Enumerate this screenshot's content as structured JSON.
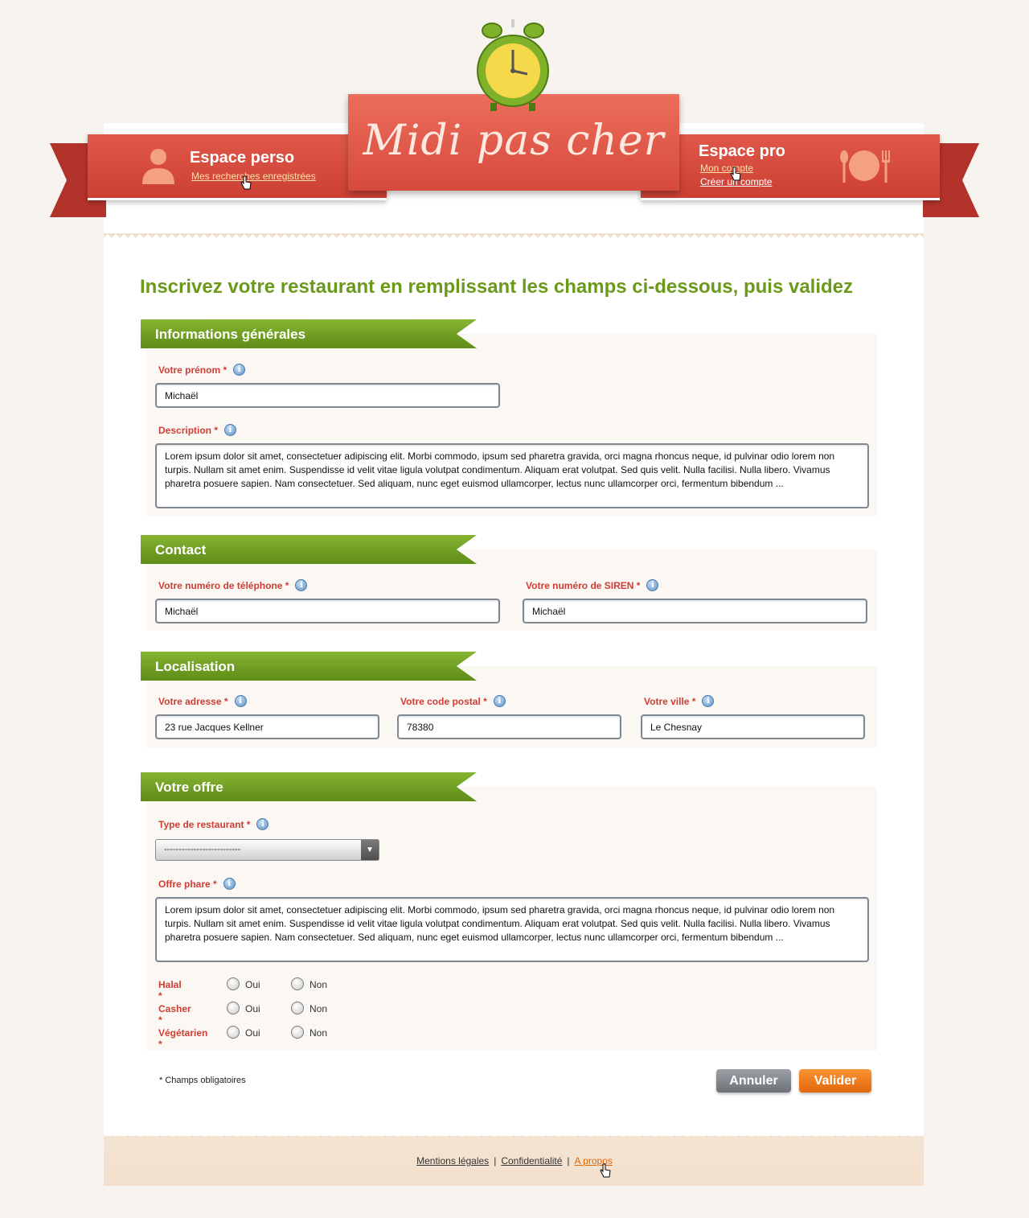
{
  "brand": {
    "logo_text": "Midi pas cher",
    "ribbon_color": "#d94b3d",
    "green_accent": "#6a9a1a"
  },
  "header": {
    "perso": {
      "title": "Espace perso",
      "link": "Mes recherches enregistrées",
      "icon": "user-icon"
    },
    "pro": {
      "title": "Espace pro",
      "links": [
        "Mon compte",
        "Créer un compte"
      ],
      "icon": "plate-cutlery-icon"
    }
  },
  "page_title": "Inscrivez votre restaurant en remplissant les champs ci-dessous, puis validez",
  "sections": {
    "general": {
      "title": "Informations générales",
      "firstname_label": "Votre prénom *",
      "firstname_value": "Michaël",
      "description_label": "Description *",
      "description_value": "Lorem ipsum dolor sit amet, consectetuer adipiscing elit. Morbi commodo, ipsum sed pharetra gravida, orci magna rhoncus neque, id pulvinar odio lorem non turpis. Nullam sit amet enim. Suspendisse id velit vitae ligula volutpat condimentum. Aliquam erat volutpat. Sed quis velit. Nulla facilisi. Nulla libero. Vivamus pharetra posuere sapien. Nam consectetuer. Sed aliquam, nunc eget euismod ullamcorper, lectus nunc ullamcorper orci, fermentum bibendum ..."
    },
    "contact": {
      "title": "Contact",
      "phone_label": "Votre numéro de téléphone *",
      "phone_value": "Michaël",
      "siren_label": "Votre numéro de SIREN *",
      "siren_value": "Michaël"
    },
    "location": {
      "title": "Localisation",
      "address_label": "Votre adresse *",
      "address_value": "23 rue Jacques Kellner",
      "zip_label": "Votre code postal *",
      "zip_value": "78380",
      "city_label": "Votre ville *",
      "city_value": "Le Chesnay"
    },
    "offer": {
      "title": "Votre offre",
      "type_label": "Type de restaurant *",
      "type_value": "--------------------------",
      "flagship_label": "Offre phare *",
      "flagship_value": "Lorem ipsum dolor sit amet, consectetuer adipiscing elit. Morbi commodo, ipsum sed pharetra gravida, orci magna rhoncus neque, id pulvinar odio lorem non turpis. Nullam sit amet enim. Suspendisse id velit vitae ligula volutpat condimentum. Aliquam erat volutpat. Sed quis velit. Nulla facilisi. Nulla libero. Vivamus pharetra posuere sapien. Nam consectetuer. Sed aliquam, nunc eget euismod ullamcorper, lectus nunc ullamcorper orci, fermentum bibendum ...",
      "options": [
        {
          "label": "Halal *",
          "yes": "Oui",
          "no": "Non"
        },
        {
          "label": "Casher *",
          "yes": "Oui",
          "no": "Non"
        },
        {
          "label": "Végétarien *",
          "yes": "Oui",
          "no": "Non"
        }
      ]
    }
  },
  "required_note": "* Champs obligatoires",
  "buttons": {
    "cancel": "Annuler",
    "submit": "Valider"
  },
  "footer": {
    "links": [
      "Mentions légales",
      "Confidentialité",
      "A propos"
    ]
  }
}
